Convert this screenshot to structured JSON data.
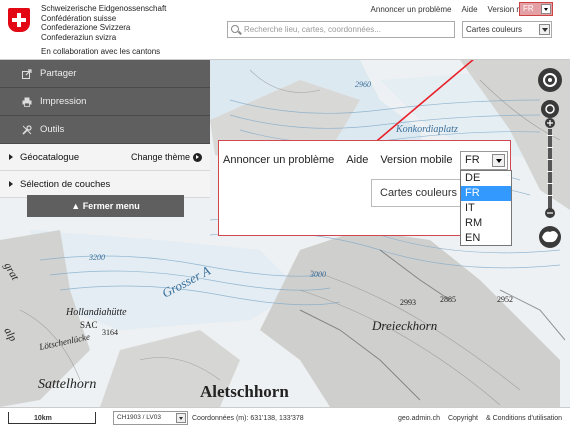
{
  "header": {
    "confederation_lines": [
      "Schweizerische Eidgenossenschaft",
      "Confédération suisse",
      "Confederazione Svizzera",
      "Confederaziun svizra"
    ],
    "subtitle": "En collaboration avec les cantons",
    "links": {
      "report": "Annoncer un problème",
      "help": "Aide",
      "mobile": "Version mobile"
    },
    "language": "FR",
    "search_placeholder": "Recherche lieu, cartes, coordonnées...",
    "layer": "Cartes couleurs"
  },
  "sidebar": {
    "items": [
      {
        "label": "Partager",
        "icon": "share-icon"
      },
      {
        "label": "Impression",
        "icon": "print-icon"
      },
      {
        "label": "Outils",
        "icon": "tools-icon"
      }
    ],
    "panels": [
      {
        "label": "Géocatalogue",
        "right": "Change thème"
      },
      {
        "label": "Sélection de couches"
      }
    ],
    "close_label": "▲ Fermer menu"
  },
  "callout": {
    "links": {
      "report": "Annoncer un problème",
      "help": "Aide",
      "mobile": "Version mobile"
    },
    "selected_language": "FR",
    "layer": "Cartes couleurs",
    "language_options": [
      "DE",
      "FR",
      "IT",
      "RM",
      "EN"
    ],
    "highlighted_option": "FR"
  },
  "map": {
    "labels": [
      "2960",
      "Konkordiaplatz",
      "3200",
      "Grosser A",
      "3000",
      "Hollandiahütte",
      "SAC",
      "3164",
      "Lötschenlücke",
      "Sattelhorn",
      "Aletschhorn",
      "Dreieckhorn",
      "2952",
      "2885",
      "2993",
      "grat",
      "alp"
    ]
  },
  "footer": {
    "scale_label": "10km",
    "projection": "CH1903 / LV03",
    "coordinates": "Coordonnées (m): 631'138, 133'378",
    "site": "geo.admin.ch",
    "copyright": "Copyright",
    "terms": "& Conditions d'utilisation"
  },
  "colors": {
    "accent_red": "#d0474f",
    "sidebar_dark": "#5f5f5f",
    "swiss_red": "#e30613",
    "highlight_blue": "#3399ff"
  }
}
